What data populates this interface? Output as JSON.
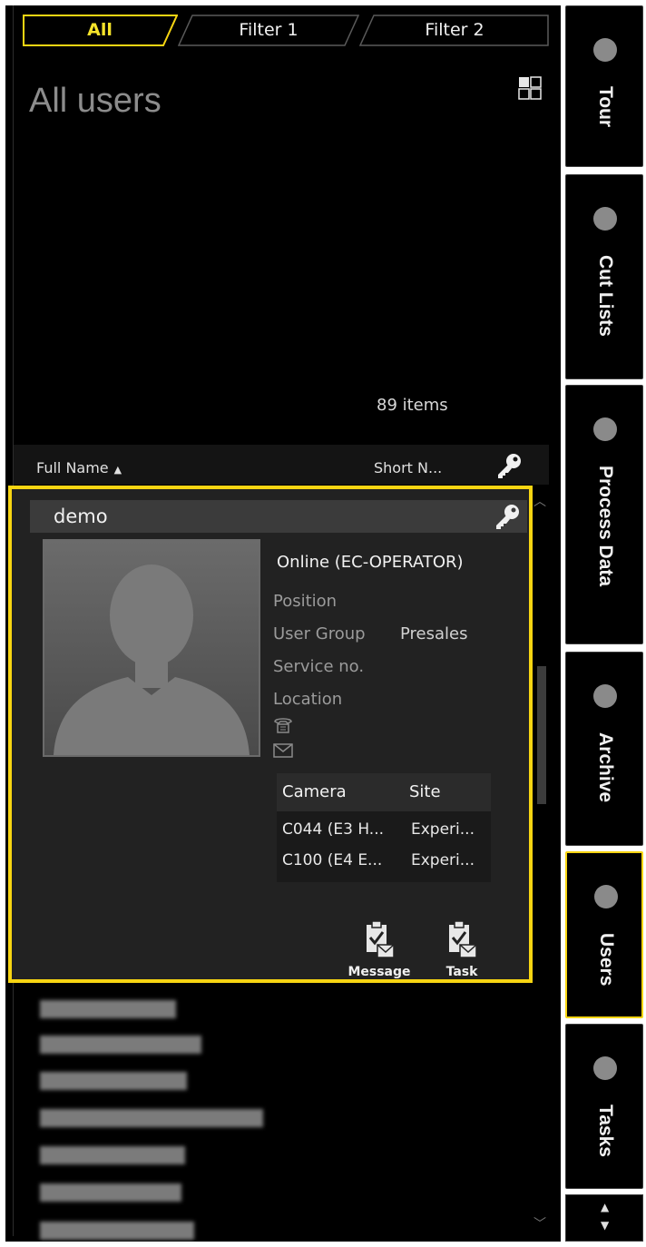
{
  "filter_tabs": [
    {
      "label": "All"
    },
    {
      "label": "Filter 1"
    },
    {
      "label": "Filter 2"
    }
  ],
  "page": {
    "title": "All users",
    "item_count": "89 items",
    "view_toggle_icon": "grid-view-icon"
  },
  "list_header": {
    "full_name": "Full Name",
    "sort_indicator": "▲",
    "short_name": "Short N...",
    "key_icon": "key-icon"
  },
  "selected_user": {
    "name": "demo",
    "status": "Online (EC-OPERATOR)",
    "fields": {
      "position_label": "Position",
      "user_group_label": "User Group",
      "user_group_value": "Presales",
      "service_no_label": "Service no.",
      "location_label": "Location"
    },
    "camera_table": {
      "headers": [
        "Camera",
        "Site"
      ],
      "rows": [
        [
          "C044 (E3 H...",
          "Experi..."
        ],
        [
          "C100 (E4 E...",
          "Experi..."
        ]
      ]
    },
    "actions": {
      "message": "Message",
      "task": "Task"
    }
  },
  "side_tabs": [
    {
      "label": "Tour"
    },
    {
      "label": "Cut Lists"
    },
    {
      "label": "Process Data"
    },
    {
      "label": "Archive"
    },
    {
      "label": "Users",
      "active": true
    },
    {
      "label": "Tasks"
    }
  ],
  "colors": {
    "accent": "#f7d512",
    "background": "#000000",
    "card": "#222222"
  }
}
